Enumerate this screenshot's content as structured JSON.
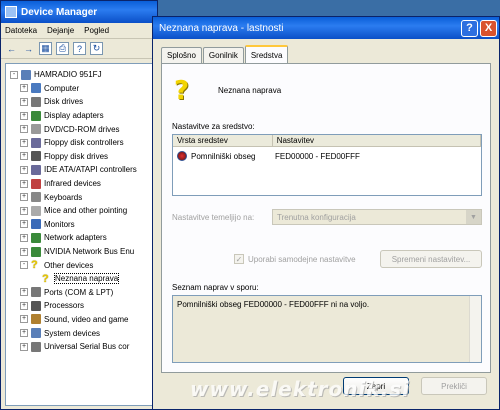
{
  "dm": {
    "title": "Device Manager",
    "menu": [
      "Datoteka",
      "Dejanje",
      "Pogled"
    ],
    "toolbar": [
      "back-icon",
      "forward-icon",
      "properties-icon",
      "print-icon",
      "help-icon",
      "refresh-icon"
    ],
    "tree": [
      {
        "level": 0,
        "expander": "-",
        "label": "HAMRADIO 951FJ",
        "icon": "#5a7fb8"
      },
      {
        "level": 1,
        "expander": "+",
        "label": "Computer",
        "icon": "#4a7ac0"
      },
      {
        "level": 1,
        "expander": "+",
        "label": "Disk drives",
        "icon": "#777"
      },
      {
        "level": 1,
        "expander": "+",
        "label": "Display adapters",
        "icon": "#3a8a3a"
      },
      {
        "level": 1,
        "expander": "+",
        "label": "DVD/CD-ROM drives",
        "icon": "#999"
      },
      {
        "level": 1,
        "expander": "+",
        "label": "Floppy disk controllers",
        "icon": "#6a6a9a"
      },
      {
        "level": 1,
        "expander": "+",
        "label": "Floppy disk drives",
        "icon": "#555"
      },
      {
        "level": 1,
        "expander": "+",
        "label": "IDE ATA/ATAPI controllers",
        "icon": "#6a6a9a"
      },
      {
        "level": 1,
        "expander": "+",
        "label": "Infrared devices",
        "icon": "#c04040"
      },
      {
        "level": 1,
        "expander": "+",
        "label": "Keyboards",
        "icon": "#888"
      },
      {
        "level": 1,
        "expander": "+",
        "label": "Mice and other pointing",
        "icon": "#aaa"
      },
      {
        "level": 1,
        "expander": "+",
        "label": "Monitors",
        "icon": "#3a6ab8"
      },
      {
        "level": 1,
        "expander": "+",
        "label": "Network adapters",
        "icon": "#3a8a3a"
      },
      {
        "level": 1,
        "expander": "+",
        "label": "NVIDIA Network Bus Enu",
        "icon": "#3a8a3a"
      },
      {
        "level": 1,
        "expander": "-",
        "label": "Other devices",
        "icon": "question"
      },
      {
        "level": 2,
        "expander": "",
        "label": "Neznana naprava",
        "icon": "question",
        "selected": true
      },
      {
        "level": 1,
        "expander": "+",
        "label": "Ports (COM & LPT)",
        "icon": "#777"
      },
      {
        "level": 1,
        "expander": "+",
        "label": "Processors",
        "icon": "#555"
      },
      {
        "level": 1,
        "expander": "+",
        "label": "Sound, video and game",
        "icon": "#b08030"
      },
      {
        "level": 1,
        "expander": "+",
        "label": "System devices",
        "icon": "#5a7fb8"
      },
      {
        "level": 1,
        "expander": "+",
        "label": "Universal Serial Bus cor",
        "icon": "#777"
      }
    ]
  },
  "dlg": {
    "title": "Neznana naprava - lastnosti",
    "help": "?",
    "close": "X",
    "tabs": [
      "Splošno",
      "Gonilnik",
      "Sredstva"
    ],
    "active_tab": 2,
    "device_name": "Neznana naprava",
    "settings_label": "Nastavitve za sredstvo:",
    "col_type": "Vrsta sredstev",
    "col_setting": "Nastavitev",
    "resource_type": "Pomnilniški obseg",
    "resource_value": "FED00000 - FED00FFF",
    "based_on_label": "Nastavitve temeljijo na:",
    "based_on_value": "Trenutna konfiguracija",
    "auto_label": "Uporabi samodejne nastavitve",
    "change_btn": "Spremeni nastavitev...",
    "conflict_label": "Seznam naprav v sporu:",
    "conflict_text": "Pomnilniški obseg FED00000 - FED00FFF ni na voljo.",
    "ok_btn": "Zapri",
    "cancel_btn": "Prekliči"
  },
  "watermark": "www.elektronik.si"
}
